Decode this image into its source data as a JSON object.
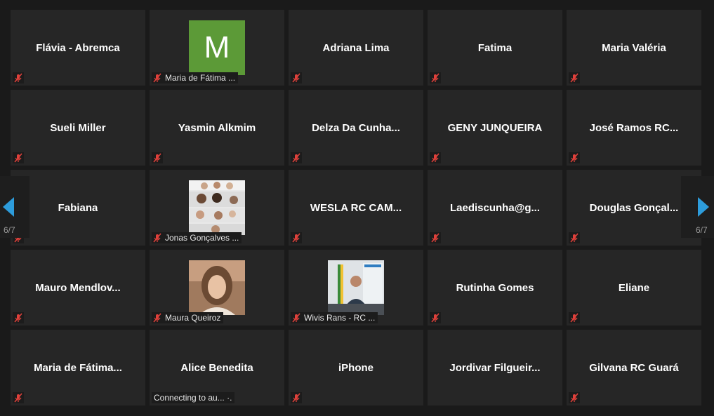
{
  "navigation": {
    "page_indicator_left": "6/7",
    "page_indicator_right": "6/7"
  },
  "colors": {
    "background": "#1a1a1a",
    "tile": "#262626",
    "muted_icon": "#e0413b",
    "arrow": "#2d9cdb",
    "avatar_green": "#5c9a37"
  },
  "participants": [
    {
      "name": "Flávia - Abremca",
      "muted": true
    },
    {
      "name": "Maria de Fátima ...",
      "avatar_letter": "M",
      "caption": true,
      "muted": true
    },
    {
      "name": "Adriana Lima",
      "muted": true
    },
    {
      "name": "Fatima",
      "muted": true
    },
    {
      "name": "Maria Valéria",
      "muted": true
    },
    {
      "name": "Sueli Miller",
      "muted": true
    },
    {
      "name": "Yasmin Alkmim",
      "muted": true
    },
    {
      "name": "Delza Da Cunha...",
      "muted": true
    },
    {
      "name": "GENY JUNQUEIRA",
      "muted": true
    },
    {
      "name": "José Ramos RC...",
      "muted": true
    },
    {
      "name": "Fabiana",
      "muted": true
    },
    {
      "name": "Jonas Gonçalves ...",
      "video": "collage",
      "caption": true,
      "muted": true
    },
    {
      "name": "WESLA RC CAM...",
      "muted": true
    },
    {
      "name": "Laediscunha@g...",
      "muted": true
    },
    {
      "name": "Douglas Gonçal...",
      "muted": true
    },
    {
      "name": "Mauro Mendlov...",
      "muted": true
    },
    {
      "name": "Maura Queiroz",
      "video": "woman",
      "caption": true,
      "muted": true
    },
    {
      "name": "Wivis Rans - RC ...",
      "video": "office",
      "caption": true,
      "muted": true
    },
    {
      "name": "Rutinha Gomes",
      "muted": true
    },
    {
      "name": "Eliane",
      "muted": true
    },
    {
      "name": "Maria de Fátima...",
      "muted": true
    },
    {
      "name": "Alice Benedita",
      "status": "Connecting to au... ·.",
      "muted": false
    },
    {
      "name": "iPhone",
      "muted": true
    },
    {
      "name": "Jordivar Filgueir...",
      "muted": false
    },
    {
      "name": "Gilvana RC Guará",
      "muted": true
    }
  ]
}
